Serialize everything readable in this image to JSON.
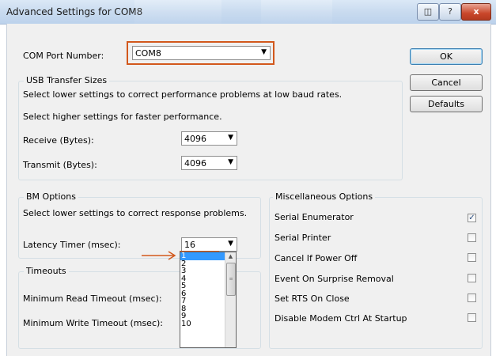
{
  "window": {
    "title": "Advanced Settings for COM8",
    "controls": {
      "context_help": "?",
      "close": "x"
    }
  },
  "com_port": {
    "label": "COM Port Number:",
    "value": "COM8"
  },
  "buttons": {
    "ok": "OK",
    "cancel": "Cancel",
    "defaults": "Defaults"
  },
  "usb_transfer": {
    "title": "USB Transfer Sizes",
    "line1": "Select lower settings to correct performance problems at low baud rates.",
    "line2": "Select higher settings for faster performance.",
    "receive_label": "Receive (Bytes):",
    "receive_value": "4096",
    "transmit_label": "Transmit (Bytes):",
    "transmit_value": "4096"
  },
  "bm_options": {
    "title": "BM Options",
    "description": "Select lower settings to correct response problems.",
    "latency_label": "Latency Timer (msec):",
    "latency_value": "16"
  },
  "latency_dropdown": {
    "options": [
      "1",
      "2",
      "3",
      "4",
      "5",
      "6",
      "7",
      "8",
      "9",
      "10"
    ],
    "selected": "1"
  },
  "timeouts": {
    "title": "Timeouts",
    "min_read_label": "Minimum Read Timeout (msec):",
    "min_write_label": "Minimum Write Timeout (msec):"
  },
  "misc": {
    "title": "Miscellaneous Options",
    "options": [
      {
        "label": "Serial Enumerator",
        "checked": true
      },
      {
        "label": "Serial Printer",
        "checked": false
      },
      {
        "label": "Cancel If Power Off",
        "checked": false
      },
      {
        "label": "Event On Surprise Removal",
        "checked": false
      },
      {
        "label": "Set RTS On Close",
        "checked": false
      },
      {
        "label": "Disable Modem Ctrl At Startup",
        "checked": false
      }
    ]
  },
  "annotation_color": "#d2581c",
  "selection_color": "#3399ff"
}
